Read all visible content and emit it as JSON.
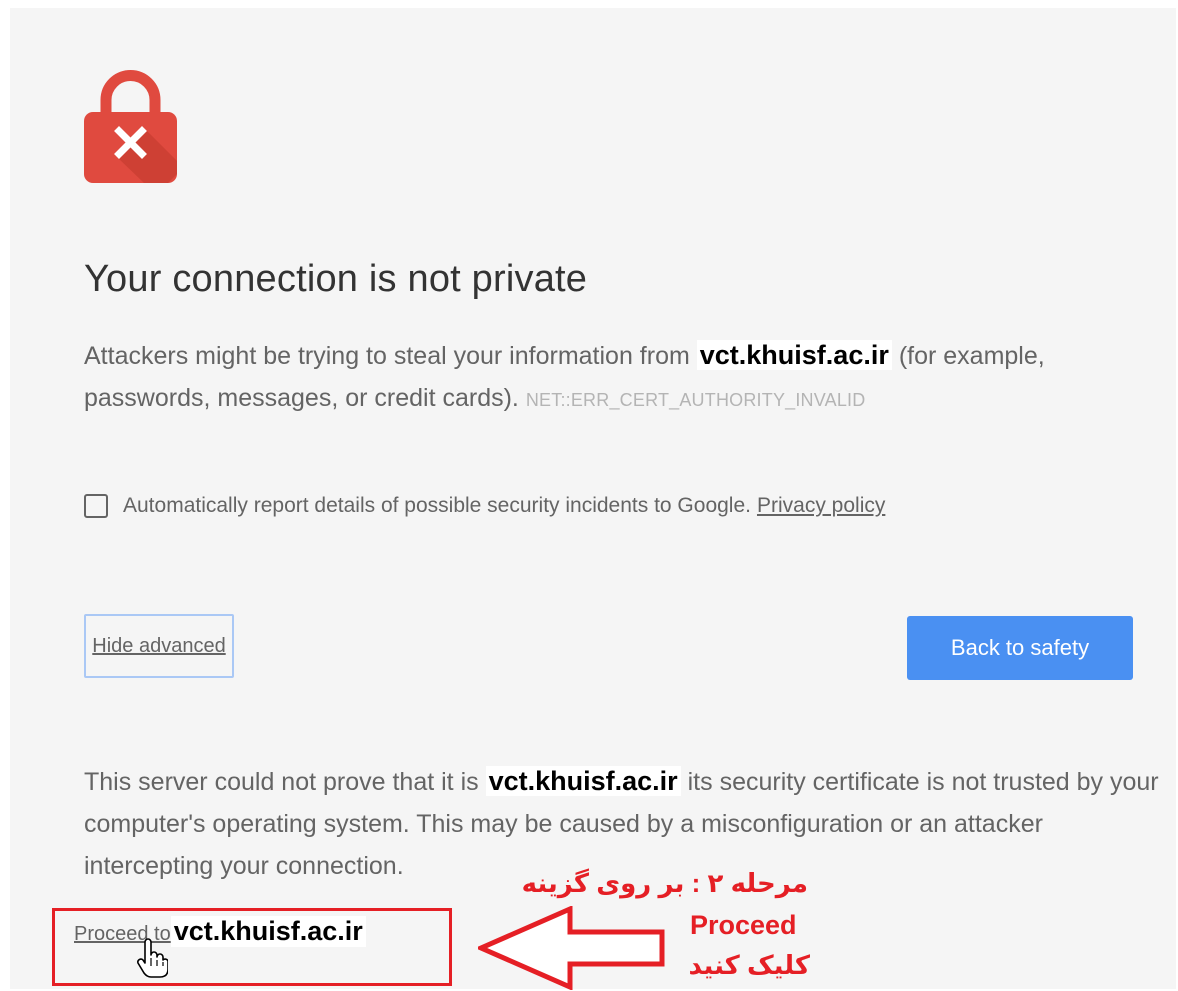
{
  "interstitial": {
    "title": "Your connection is not private",
    "intro_before": "Attackers might be trying to steal your information from",
    "intro_host": "vct.khuisf.ac.ir",
    "intro_after": "(for example, passwords, messages, or credit cards).",
    "error_code": "NET::ERR_CERT_AUTHORITY_INVALID",
    "report_label": "Automatically report details of possible security incidents to Google.",
    "privacy_link": "Privacy policy",
    "report_checked": false,
    "hide_advanced_label": "Hide advanced",
    "back_to_safety_label": "Back to safety",
    "details_before": "This server could not prove that it is",
    "details_host": "vct.khuisf.ac.ir",
    "details_after": "its security certificate is not trusted by your computer's operating system. This may be caused by a misconfiguration or an attacker intercepting your connection.",
    "proceed_link": "Proceed to",
    "proceed_host": "vct.khuisf.ac.ir"
  },
  "annotation": {
    "line1": "مرحله ۲ : بر روی گزینه",
    "line2": "Proceed",
    "line3": "کلیک کنید"
  },
  "colors": {
    "lock_red": "#e04a3f",
    "primary_button": "#4a90f2",
    "annotation_red": "#e51f25",
    "page_background": "#f5f5f5"
  },
  "icons": {
    "lock": "lock-error-icon",
    "cursor": "hand-pointer-icon",
    "arrow": "left-arrow-icon"
  }
}
